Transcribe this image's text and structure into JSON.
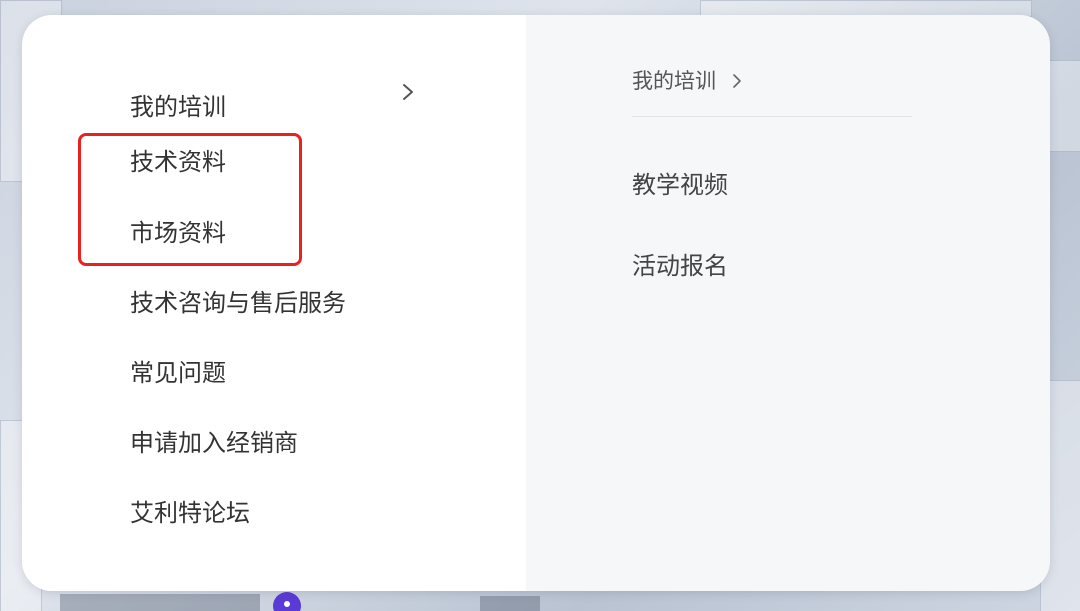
{
  "menu": {
    "items": [
      {
        "label": "我的培训",
        "has_chevron": true
      },
      {
        "label": "技术资料"
      },
      {
        "label": "市场资料"
      },
      {
        "label": "技术咨询与售后服务"
      },
      {
        "label": "常见问题"
      },
      {
        "label": "申请加入经销商"
      },
      {
        "label": "艾利特论坛"
      }
    ]
  },
  "submenu": {
    "title": "我的培训",
    "items": [
      {
        "label": "教学视频"
      },
      {
        "label": "活动报名"
      }
    ]
  },
  "icons": {
    "menu_chevron": "chevron-right-icon",
    "submenu_chevron": "chevron-right-icon"
  },
  "colors": {
    "highlight": "#e8231f",
    "left_bg": "#ffffff",
    "right_bg": "#f6f7f9",
    "text": "#333333",
    "indicator": "#5b3bd6"
  }
}
